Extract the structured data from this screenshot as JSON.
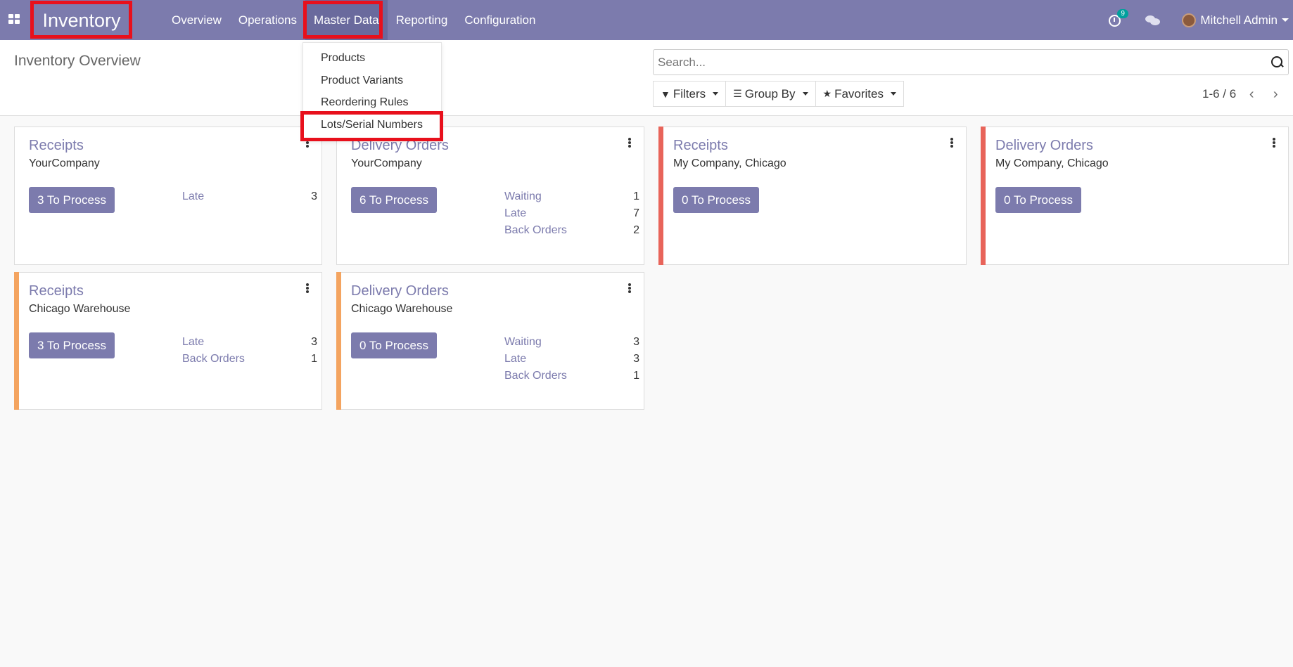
{
  "app": {
    "title": "Inventory"
  },
  "nav": {
    "items": [
      {
        "label": "Overview"
      },
      {
        "label": "Operations"
      },
      {
        "label": "Master Data"
      },
      {
        "label": "Reporting"
      },
      {
        "label": "Configuration"
      }
    ],
    "activity_count": "9",
    "user": "Mitchell Admin"
  },
  "dropdown": {
    "items": [
      {
        "label": "Products"
      },
      {
        "label": "Product Variants"
      },
      {
        "label": "Reordering Rules"
      },
      {
        "label": "Lots/Serial Numbers"
      }
    ]
  },
  "control": {
    "title": "Inventory Overview",
    "search_placeholder": "Search...",
    "filters": "Filters",
    "group_by": "Group By",
    "favorites": "Favorites",
    "pager": "1-6 / 6"
  },
  "colors": {
    "brand": "#7c7bad",
    "red_bar": "#e8645a",
    "orange_bar": "#f4a460",
    "highlight": "#e8101c"
  },
  "cards": [
    {
      "title": "Receipts",
      "sub": "YourCompany",
      "button": "3 To Process",
      "bar": "",
      "stats": [
        {
          "label": "Late",
          "value": "3"
        }
      ]
    },
    {
      "title": "Delivery Orders",
      "sub": "YourCompany",
      "button": "6 To Process",
      "bar": "",
      "stats": [
        {
          "label": "Waiting",
          "value": "1"
        },
        {
          "label": "Late",
          "value": "7"
        },
        {
          "label": "Back Orders",
          "value": "2"
        }
      ]
    },
    {
      "title": "Receipts",
      "sub": "My Company, Chicago",
      "button": "0 To Process",
      "bar": "red",
      "stats": []
    },
    {
      "title": "Delivery Orders",
      "sub": "My Company, Chicago",
      "button": "0 To Process",
      "bar": "red",
      "stats": []
    },
    {
      "title": "Receipts",
      "sub": "Chicago Warehouse",
      "button": "3 To Process",
      "bar": "orange",
      "stats": [
        {
          "label": "Late",
          "value": "3"
        },
        {
          "label": "Back Orders",
          "value": "1"
        }
      ]
    },
    {
      "title": "Delivery Orders",
      "sub": "Chicago Warehouse",
      "button": "0 To Process",
      "bar": "orange",
      "stats": [
        {
          "label": "Waiting",
          "value": "3"
        },
        {
          "label": "Late",
          "value": "3"
        },
        {
          "label": "Back Orders",
          "value": "1"
        }
      ]
    }
  ]
}
